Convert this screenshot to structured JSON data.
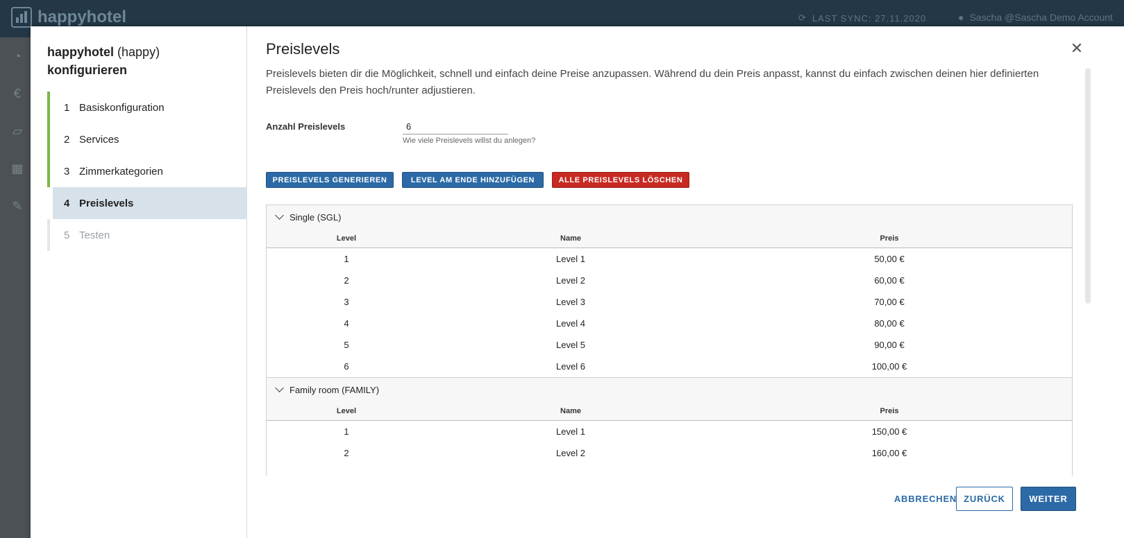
{
  "app": {
    "name": "happyhotel",
    "sync_text": "LAST SYNC: 27.11.2020",
    "user_text": "Sascha @Sascha Demo Account"
  },
  "modal": {
    "title_name": "happyhotel",
    "title_sub": "(happy)",
    "title_line2": "konfigurieren",
    "steps": [
      {
        "num": "1",
        "label": "Basiskonfiguration"
      },
      {
        "num": "2",
        "label": "Services"
      },
      {
        "num": "3",
        "label": "Zimmerkategorien"
      },
      {
        "num": "4",
        "label": "Preislevels"
      },
      {
        "num": "5",
        "label": "Testen"
      }
    ]
  },
  "page": {
    "title": "Preislevels",
    "description": "Preislevels bieten dir die Möglichkeit, schnell und einfach deine Preise anzupassen. Während du dein Preis anpasst, kannst du einfach zwischen deinen hier definierten Preislevels den Preis hoch/runter adjustieren.",
    "field_label": "Anzahl Preislevels",
    "field_value": "6",
    "field_help": "Wie viele Preislevels willst du anlegen?",
    "btn_generate": "PREISLEVELS GENERIEREN",
    "btn_add": "LEVEL AM ENDE HINZUFÜGEN",
    "btn_delete": "ALLE PREISLEVELS LÖSCHEN"
  },
  "table": {
    "col_level": "Level",
    "col_name": "Name",
    "col_price": "Preis",
    "groups": [
      {
        "title": "Single (SGL)",
        "rows": [
          {
            "level": "1",
            "name": "Level 1",
            "price": "50,00 €"
          },
          {
            "level": "2",
            "name": "Level 2",
            "price": "60,00 €"
          },
          {
            "level": "3",
            "name": "Level 3",
            "price": "70,00 €"
          },
          {
            "level": "4",
            "name": "Level 4",
            "price": "80,00 €"
          },
          {
            "level": "5",
            "name": "Level 5",
            "price": "90,00 €"
          },
          {
            "level": "6",
            "name": "Level 6",
            "price": "100,00 €"
          }
        ]
      },
      {
        "title": "Family room (FAMILY)",
        "rows": [
          {
            "level": "1",
            "name": "Level 1",
            "price": "150,00 €"
          },
          {
            "level": "2",
            "name": "Level 2",
            "price": "160,00 €"
          }
        ]
      }
    ]
  },
  "footer": {
    "cancel": "ABBRECHEN",
    "back": "ZURÜCK",
    "next": "WEITER"
  },
  "colors": {
    "primary": "#2b6aa6",
    "danger": "#c62a22",
    "step_done": "#7ab648",
    "step_active_bg": "#d6e1e9"
  }
}
